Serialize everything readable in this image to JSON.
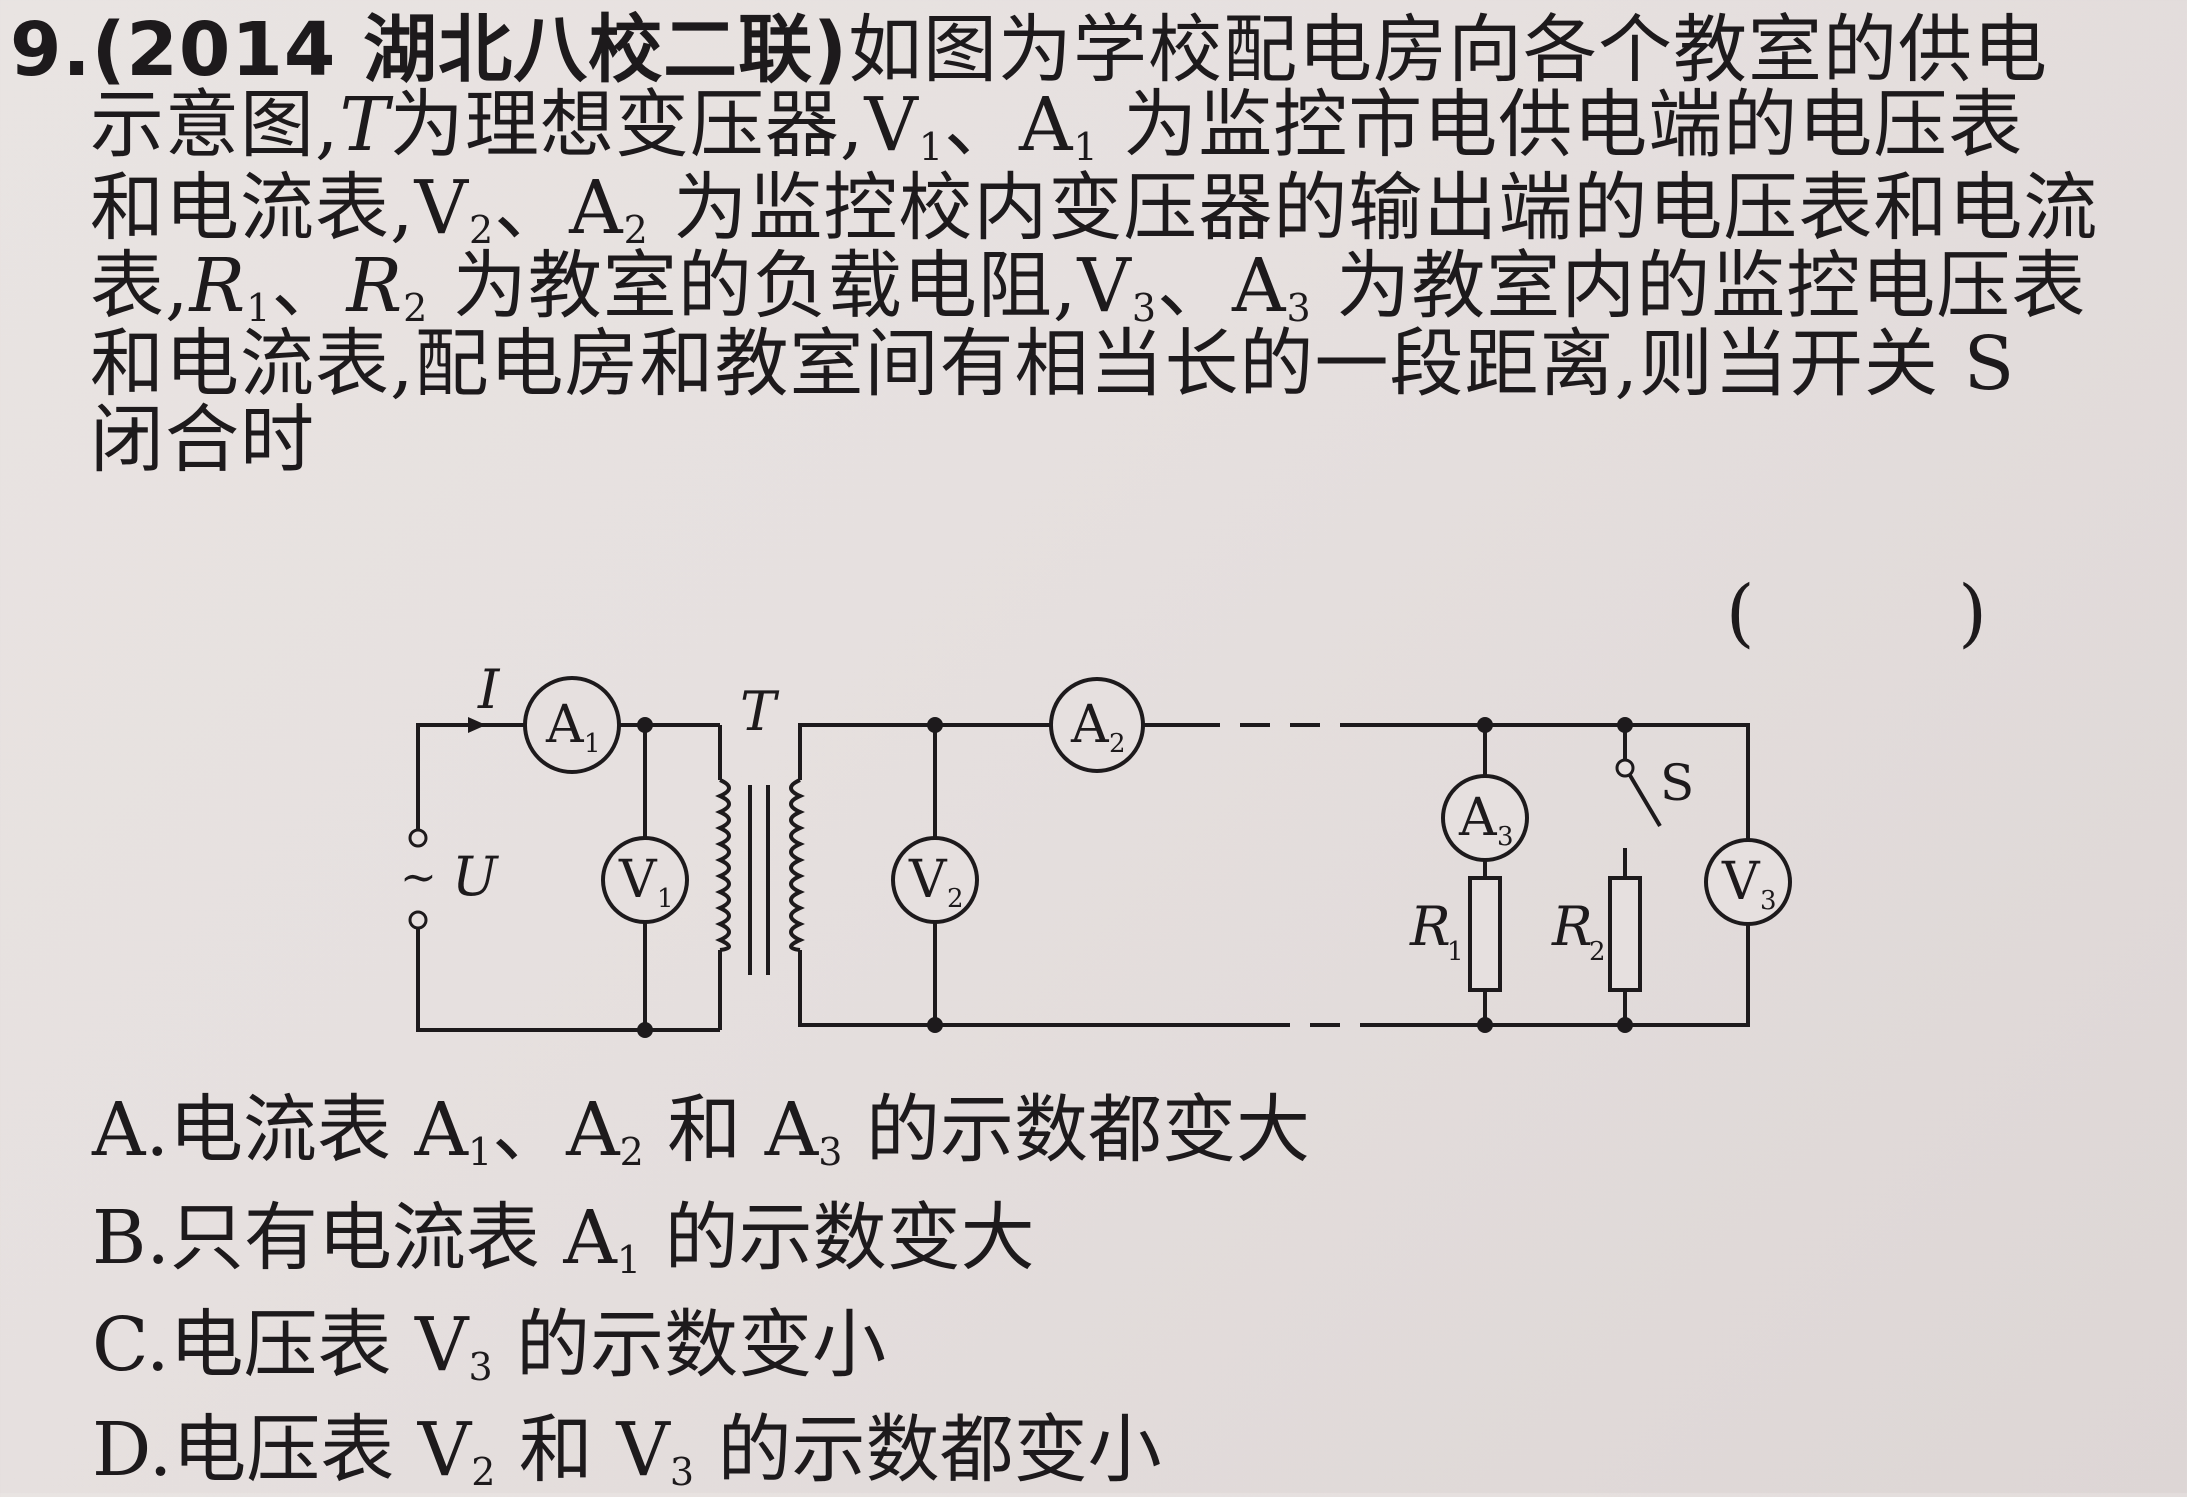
{
  "question": {
    "number": "9.",
    "source": "(2014 湖北八校二联)",
    "line1": "如图为学校配电房向各个教室的供电",
    "line2_a": "示意图,",
    "line2_T": "T",
    "line2_b": "为理想变压器,V",
    "line2_c": "、A",
    "line2_d": "为监控市电供电端的电压表",
    "line3_a": "和电流表,V",
    "line3_b": "、A",
    "line3_c": "为监控校内变压器的输出端的电压表和电流",
    "line4_a": "表,",
    "line4_R1": "R",
    "line4_sep": "、",
    "line4_R2": "R",
    "line4_b": "为教室的负载电阻,V",
    "line4_c": "、A",
    "line4_d": "为教室内的监控电压表",
    "line5": "和电流表,配电房和教室间有相当长的一段距离,则当开关 S",
    "line6": "闭合时",
    "bracket": "(  )",
    "sub1": "1",
    "sub2": "2",
    "sub3": "3"
  },
  "diagram": {
    "label_I": "I",
    "label_U": "U",
    "label_T": "T",
    "label_S": "S",
    "label_tilde": "~",
    "label_R1": "R",
    "label_R2": "R",
    "meters": {
      "A1": {
        "letter": "A",
        "sub": "1"
      },
      "A2": {
        "letter": "A",
        "sub": "2"
      },
      "A3": {
        "letter": "A",
        "sub": "3"
      },
      "V1": {
        "letter": "V",
        "sub": "1"
      },
      "V2": {
        "letter": "V",
        "sub": "2"
      },
      "V3": {
        "letter": "V",
        "sub": "3"
      }
    }
  },
  "options": {
    "A": {
      "prefix": "A.电流表 A",
      "s1": "1",
      "mid1": "、A",
      "s2": "2",
      "mid2": " 和 A",
      "s3": "3",
      "tail": " 的示数都变大"
    },
    "B": {
      "prefix": "B.只有电流表 A",
      "s1": "1",
      "tail": " 的示数变大"
    },
    "C": {
      "prefix": "C.电压表 V",
      "s1": "3",
      "tail": " 的示数变小"
    },
    "D": {
      "prefix": "D.电压表 V",
      "s1": "2",
      "mid1": " 和 V",
      "s2": "3",
      "tail": " 的示数都变小"
    }
  }
}
